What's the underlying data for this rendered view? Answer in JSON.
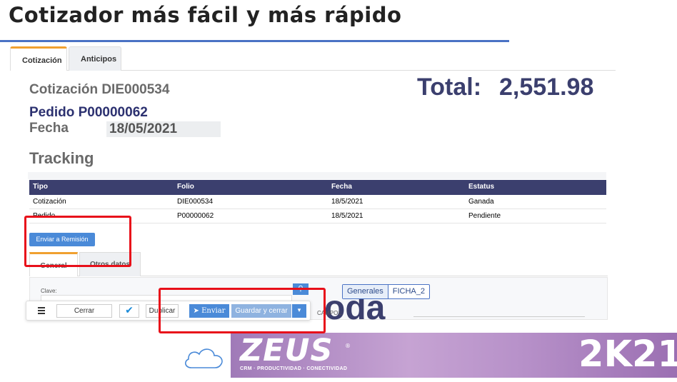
{
  "slide": {
    "title": "Cotizador más fácil y más rápido"
  },
  "tabs": [
    {
      "label": "Cotización"
    },
    {
      "label": "Anticipos"
    }
  ],
  "quote": {
    "title": "Cotización DIE000534",
    "order": "Pedido P00000062",
    "date_label": "Fecha",
    "date_value": "18/05/2021",
    "total_label": "Total:",
    "total_value": "2,551.98"
  },
  "tracking": {
    "title": "Tracking",
    "headers": {
      "tipo": "Tipo",
      "folio": "Folio",
      "fecha": "Fecha",
      "estatus": "Estatus"
    },
    "rows": [
      {
        "tipo": "Cotización",
        "folio": "DIE000534",
        "fecha": "18/5/2021",
        "estatus": "Ganada"
      },
      {
        "tipo": "Pedido",
        "folio": "P00000062",
        "fecha": "18/5/2021",
        "estatus": "Pendiente"
      }
    ]
  },
  "actions": {
    "send_remission": "Enviar a Remisión"
  },
  "subtabs": [
    {
      "label": "General"
    },
    {
      "label": "Otros datos"
    }
  ],
  "form": {
    "clave_label": "Clave:",
    "ficha_buttons": [
      "Generales",
      "FICHA_2"
    ],
    "campo_label": "CAMPO1:",
    "overlay_text": "oda"
  },
  "toolbar": {
    "close": "Cerrar",
    "duplicate": "Duplicar",
    "send": "Enviar",
    "save_close": "Guardar y cerrar"
  },
  "branding": {
    "logo_text": "ZEUS",
    "logo_reg": "®",
    "tagline": "CRM · PRODUCTIVIDAD · CONECTIVIDAD",
    "year": "2K21"
  },
  "colors": {
    "accent_blue": "#4a8ad8",
    "header_navy": "#3b3f6e",
    "highlight_red": "#e8101a",
    "tab_orange": "#f0a030",
    "banner_purple": "#a07ab8"
  }
}
